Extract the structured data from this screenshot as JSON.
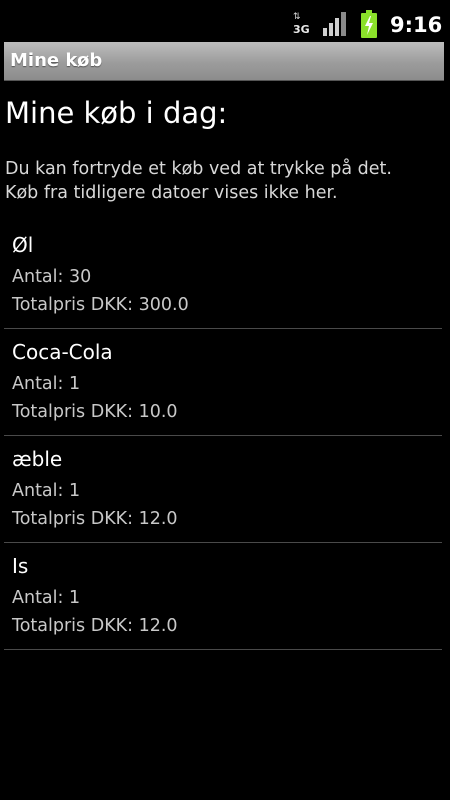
{
  "status_bar": {
    "network_label": "3G",
    "network_arrows": "⇅",
    "clock": "9:16",
    "battery_color": "#8be02a"
  },
  "title_bar": {
    "title": "Mine køb"
  },
  "main": {
    "heading": "Mine køb i dag:",
    "info_line_1": "Du kan fortryde et køb ved at trykke på det.",
    "info_line_2": "Køb fra tidligere datoer vises ikke her."
  },
  "purchases": [
    {
      "name": "Øl",
      "quantity": "Antal: 30",
      "total": "Totalpris DKK: 300.0"
    },
    {
      "name": "Coca-Cola",
      "quantity": "Antal: 1",
      "total": "Totalpris DKK: 10.0"
    },
    {
      "name": "æble",
      "quantity": "Antal: 1",
      "total": "Totalpris DKK: 12.0"
    },
    {
      "name": "Is",
      "quantity": "Antal: 1",
      "total": "Totalpris DKK: 12.0"
    }
  ]
}
